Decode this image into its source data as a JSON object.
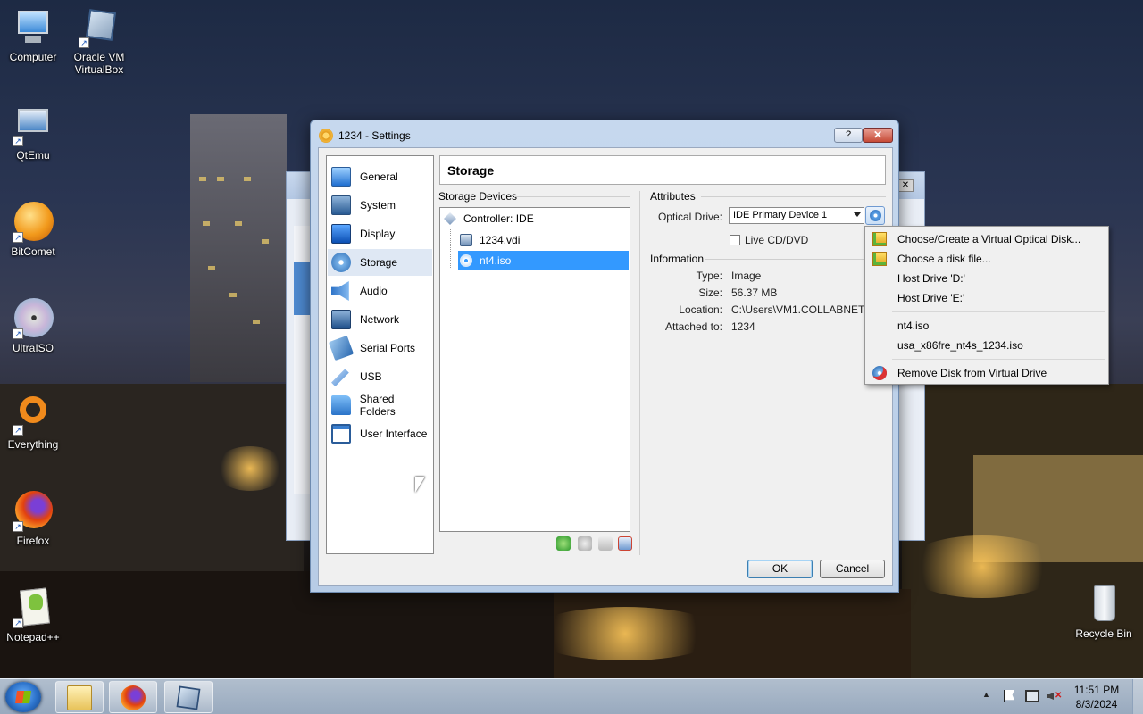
{
  "desktop": {
    "icons": [
      {
        "label": "Computer"
      },
      {
        "label": "Oracle VM\nVirtualBox"
      },
      {
        "label": "QtEmu"
      },
      {
        "label": "BitComet"
      },
      {
        "label": "UltraISO"
      },
      {
        "label": "Everything"
      },
      {
        "label": "Firefox"
      },
      {
        "label": "Notepad++"
      },
      {
        "label": "Recycle Bin"
      }
    ]
  },
  "dialog": {
    "title": "1234 - Settings",
    "help_label": "?",
    "close_label": "✕",
    "nav": [
      {
        "label": "General"
      },
      {
        "label": "System"
      },
      {
        "label": "Display"
      },
      {
        "label": "Storage"
      },
      {
        "label": "Audio"
      },
      {
        "label": "Network"
      },
      {
        "label": "Serial Ports"
      },
      {
        "label": "USB"
      },
      {
        "label": "Shared Folders"
      },
      {
        "label": "User Interface"
      }
    ],
    "selected_nav": "Storage",
    "header": "Storage",
    "storage_devices_label": "Storage Devices",
    "tree": [
      {
        "label": "Controller: IDE"
      },
      {
        "label": "1234.vdi"
      },
      {
        "label": "nt4.iso"
      }
    ],
    "attributes_label": "Attributes",
    "optical_drive_label": "Optical Drive:",
    "optical_drive_value": "IDE Primary Device 1",
    "live_cd_label": "Live CD/DVD",
    "information_label": "Information",
    "info": {
      "type_label": "Type:",
      "type_value": "Image",
      "size_label": "Size:",
      "size_value": "56.37 MB",
      "location_label": "Location:",
      "location_value": "C:\\Users\\VM1.COLLABNET\\Dow",
      "attached_label": "Attached to:",
      "attached_value": "1234"
    },
    "ok_label": "OK",
    "cancel_label": "Cancel"
  },
  "menu": {
    "items": [
      {
        "label": "Choose/Create a Virtual Optical Disk..."
      },
      {
        "label": "Choose a disk file..."
      },
      {
        "label": "Host Drive 'D:'"
      },
      {
        "label": "Host Drive 'E:'"
      },
      {
        "label": "nt4.iso"
      },
      {
        "label": "usa_x86fre_nt4s_1234.iso"
      },
      {
        "label": "Remove Disk from Virtual Drive"
      }
    ]
  },
  "taskbar": {
    "time": "11:51 PM",
    "date": "8/3/2024",
    "tray_arrow": "▲"
  },
  "colors": {
    "selection": "#3399ff",
    "dialog_frame": "#b7cce6"
  }
}
